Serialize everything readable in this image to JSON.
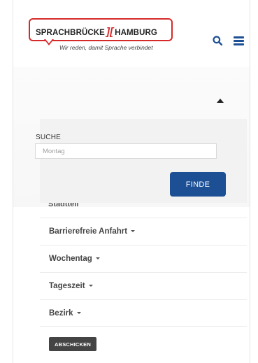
{
  "logo": {
    "left_text": "SPRACHBRÜCKE",
    "mark": "][",
    "right_text": "HAMBURG",
    "slogan": "Wir reden, damit Sprache verbindet"
  },
  "colors": {
    "brand_red": "#d62a2a",
    "brand_blue": "#1c4f94",
    "submit_dark": "#444444"
  },
  "icons": {
    "search": "search-icon",
    "menu": "hamburger-menu-icon",
    "collapse": "caret-up-icon",
    "dropdown": "caret-down-icon"
  },
  "search": {
    "label": "SUCHE",
    "placeholder": "Montag",
    "button_label": "FINDE"
  },
  "filters": {
    "partial_label": "Stadtteil",
    "items": [
      {
        "label": "Barrierefreie Anfahrt"
      },
      {
        "label": "Wochentag"
      },
      {
        "label": "Tageszeit"
      },
      {
        "label": "Bezirk"
      }
    ],
    "submit_label": "ABSCHICKEN"
  }
}
